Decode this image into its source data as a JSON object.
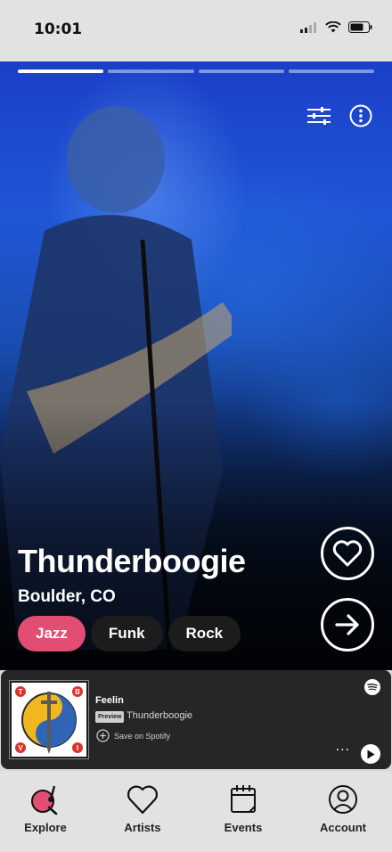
{
  "status_bar": {
    "time": "10:01"
  },
  "story": {
    "progress_segments": 4,
    "active_segment": 1,
    "artist": {
      "name": "Thunderboogie",
      "location": "Boulder, CO"
    },
    "genres": [
      {
        "label": "Jazz",
        "active": true
      },
      {
        "label": "Funk",
        "active": false
      },
      {
        "label": "Rock",
        "active": false
      }
    ],
    "icons": {
      "filter": "sliders-icon",
      "more": "more-vertical-icon",
      "favorite": "heart-icon",
      "next": "arrow-right-icon"
    }
  },
  "player": {
    "track_title": "Feelin",
    "badge": "Preview",
    "artist": "Thunderboogie",
    "save_label": "Save on Spotify",
    "more_label": "···",
    "album_art_letters": [
      "T",
      "B",
      "V",
      "I"
    ]
  },
  "tabbar": {
    "items": [
      {
        "label": "Explore",
        "icon": "explore-music-icon",
        "active": true
      },
      {
        "label": "Artists",
        "icon": "heart-outline-icon",
        "active": false
      },
      {
        "label": "Events",
        "icon": "calendar-icon",
        "active": false
      },
      {
        "label": "Account",
        "icon": "user-circle-icon",
        "active": false
      }
    ]
  },
  "colors": {
    "accent": "#e24d72",
    "chip_bg": "#1c1c1c",
    "player_bg": "#262626",
    "spotify_mark": "#ffffff"
  }
}
